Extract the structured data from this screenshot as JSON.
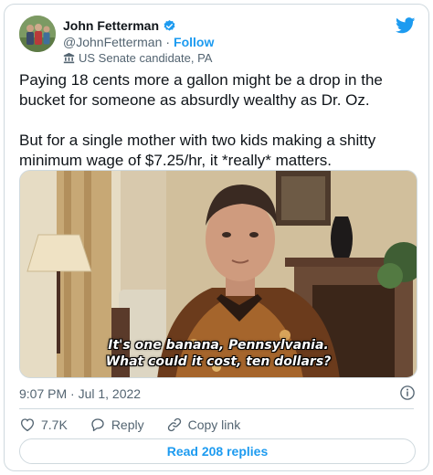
{
  "author": {
    "name": "John Fetterman",
    "handle": "@JohnFetterman",
    "separator": "·",
    "follow_label": "Follow",
    "label": "US Senate candidate, PA"
  },
  "tweet": {
    "text": "Paying 18 cents more a gallon might be a drop in the bucket for someone as absurdly wealthy as Dr. Oz.\n\nBut for a single mother with two kids making a shitty minimum wage of $7.25/hr, it *really* matters.",
    "timestamp": "9:07 PM · Jul 1, 2022"
  },
  "media": {
    "caption_line1": "It's one banana, Pennsylvania.",
    "caption_line2": "What could it cost, ten dollars?"
  },
  "actions": {
    "like_count": "7.7K",
    "reply_label": "Reply",
    "copy_link_label": "Copy link"
  },
  "read_replies_label": "Read 208 replies",
  "colors": {
    "accent": "#1d9bf0",
    "text": "#0f1419",
    "muted": "#536471",
    "border": "#cfd9de"
  },
  "icons": [
    "verified-badge-icon",
    "government-building-icon",
    "twitter-bird-icon",
    "info-icon",
    "heart-icon",
    "reply-bubble-icon",
    "link-icon"
  ]
}
